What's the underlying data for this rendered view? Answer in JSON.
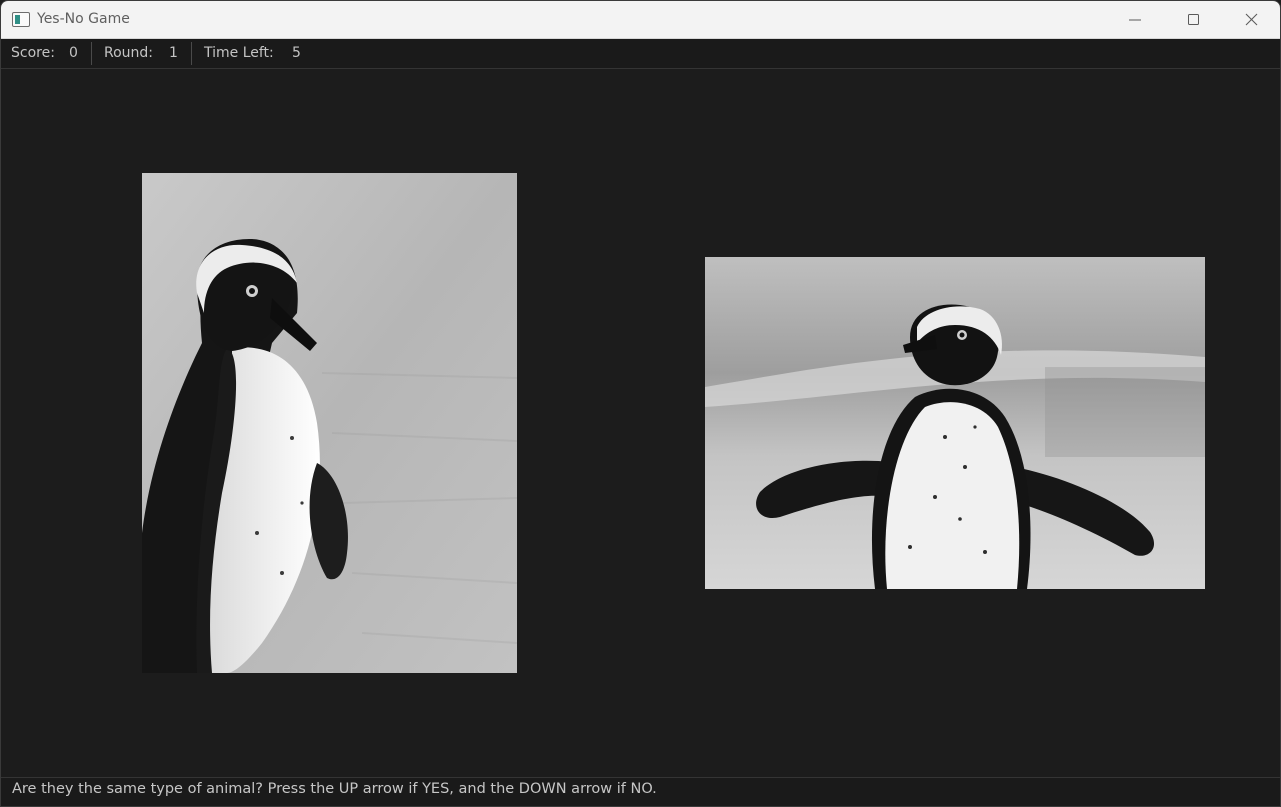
{
  "window": {
    "title": "Yes-No Game",
    "controls": [
      "minimize",
      "maximize",
      "close"
    ]
  },
  "status": {
    "score_label": "Score:",
    "score_value": "0",
    "round_label": "Round:",
    "round_value": "1",
    "time_label": "Time Left:",
    "time_value": "5"
  },
  "images": [
    {
      "name": "left-penguin-image",
      "content": "penguin"
    },
    {
      "name": "right-penguin-image",
      "content": "penguin"
    }
  ],
  "footer": {
    "instruction": "Are they the same type of animal? Press the UP arrow if YES, and the DOWN arrow if NO."
  },
  "colors": {
    "background": "#1c1c1c",
    "titlebar": "#f3f3f3",
    "text": "#c8c8c8"
  }
}
